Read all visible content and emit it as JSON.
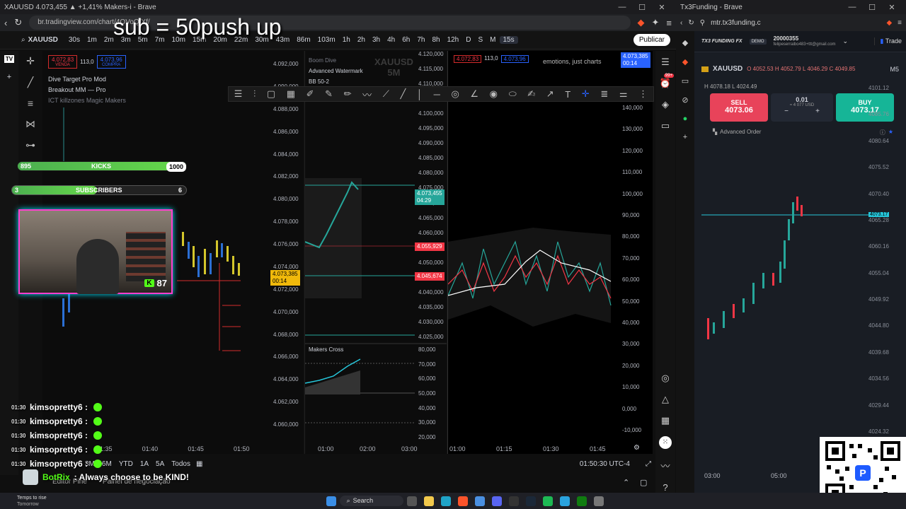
{
  "left_window": {
    "title": "XAUUSD 4.073,455 ▲ +1,41% Makers-i - Brave",
    "url": "br.tradingview.com/chart/4OVoQfXf/",
    "symbol": "XAUUSD",
    "timeframes": [
      "30s",
      "1m",
      "2m",
      "3m",
      "5m",
      "7m",
      "10m",
      "15m",
      "20m",
      "22m",
      "30m",
      "43m",
      "86m",
      "103m",
      "1h",
      "2h",
      "3h",
      "4h",
      "6h",
      "7h",
      "8h",
      "12h",
      "D",
      "S",
      "M",
      "15s"
    ],
    "active_timeframe": "15s",
    "publish_label": "Publicar",
    "sell_price": "4.072,83",
    "sell_label": "VENDA",
    "spread": "113,0",
    "buy_price": "4.073,96",
    "buy_label": "COMPRA",
    "indicators": [
      "Dive Target Pro Mod",
      "Breakout MM — Pro",
      "ICT killzones Magic Makers"
    ],
    "pane2_indicators": [
      "Boom Dive",
      "Advanced Watermark",
      "BB 50-2"
    ],
    "watermark_symbol": "XAUUSD",
    "watermark_tf": "5M",
    "pane3_text": "emotions, just charts",
    "makers_cross": "Makers Cross",
    "price_axis_1": [
      "4.092,000",
      "4.090,000",
      "4.088,000",
      "4.086,000",
      "4.084,000",
      "4.082,000",
      "4.080,000",
      "4.078,000",
      "4.076,000",
      "4.074,000",
      "4.072,000",
      "4.070,000",
      "4.068,000",
      "4.066,000",
      "4.064,000",
      "4.062,000",
      "4.060,000"
    ],
    "price_axis_2": [
      "4.120,000",
      "4.115,000",
      "4.110,000",
      "4.105,000",
      "4.100,000",
      "4.095,000",
      "4.090,000",
      "4.085,000",
      "4.080,000",
      "4.075,000",
      "4.070,000",
      "4.065,000",
      "4.060,000",
      "4.055,000",
      "4.050,000",
      "4.045,000",
      "4.040,000",
      "4.035,000",
      "4.030,000",
      "4.025,000"
    ],
    "osc_axis_2": [
      "80,000",
      "70,000",
      "60,000",
      "50,000",
      "40,000",
      "30,000",
      "20,000"
    ],
    "osc_axis_3": [
      "140,000",
      "130,000",
      "120,000",
      "110,000",
      "100,000",
      "90,000",
      "80,000",
      "70,000",
      "60,000",
      "50,000",
      "40,000",
      "30,000",
      "20,000",
      "10,000",
      "0,000",
      "-10,000"
    ],
    "price_badge_current": "4.073,385",
    "price_badge_countdown": "00:14",
    "price_badge_p2_a": "4.073,455",
    "price_badge_p2_a_sub": "04:29",
    "price_badge_p2_b": "4.055,929",
    "price_badge_p2_c": "4.045,674",
    "price_badge_p3": "4.073,385",
    "price_badge_p3_sub": "00:14",
    "times_1": [
      "01:35",
      "01:40",
      "01:45",
      "01:50"
    ],
    "times_2": [
      "01:00",
      "02:00",
      "03:00"
    ],
    "times_3": [
      "01:00",
      "01:15",
      "01:30",
      "01:45"
    ],
    "range_buttons": [
      "3M",
      "6M",
      "YTD",
      "1A",
      "5A",
      "Todos"
    ],
    "clock": "01:50:30 UTC-4",
    "bottom_tabs": [
      "Editor Pine",
      "Painel de negociação"
    ],
    "notif_count": "99+"
  },
  "overlay": {
    "headline": "sub = 50push up",
    "kicks_left": "895",
    "kicks_label": "KICKS",
    "kicks_right": "1000",
    "subs_left": "3",
    "subs_label": "SUBSCRIBERS",
    "subs_right": "6",
    "viewer_count": "87",
    "chat": [
      {
        "time": "01:30",
        "user": "kimsopretty6 :"
      },
      {
        "time": "01:30",
        "user": "kimsopretty6 :"
      },
      {
        "time": "01:30",
        "user": "kimsopretty6 :"
      },
      {
        "time": "01:30",
        "user": "kimsopretty6 :"
      },
      {
        "time": "01:30",
        "user": "kimsopretty6 :"
      }
    ],
    "bot_user": "BotRix",
    "bot_message": ": Always choose to be KIND!"
  },
  "right_window": {
    "title": "Tx3Funding - Brave",
    "url": "mtr.tx3funding.c",
    "brand": "TX3 FUNDING FX",
    "account_type": "DEMO",
    "account_id": "20000355",
    "account_email": "felipeserraibo483+ttt@gmail.com",
    "trade_tab": "Trade",
    "symbol": "XAUUSD",
    "ohlc": "O 4052.53  H 4052.79  L 4046.29  C 4049.85",
    "timeframe": "M5",
    "hl": "H 4078.18  L 4024.49",
    "sell_label": "SELL",
    "sell_price": "4073.06",
    "buy_label": "BUY",
    "buy_price": "4073.17",
    "lot": "0.01",
    "lot_usd": "≈ 4 077 USD",
    "advanced_order": "Advanced Order",
    "price_axis": [
      "4101.12",
      "4085.76",
      "4080.64",
      "4075.52",
      "4070.40",
      "4065.28",
      "4060.16",
      "4055.04",
      "4049.92",
      "4044.80",
      "4039.68",
      "4034.56",
      "4029.44",
      "4024.32"
    ],
    "current_price": "4073.17",
    "times": [
      "03:00",
      "05:00"
    ]
  },
  "taskbar": {
    "weather_line1": "Temps to rise",
    "weather_line2": "Tomorrow",
    "search_label": "Search"
  }
}
